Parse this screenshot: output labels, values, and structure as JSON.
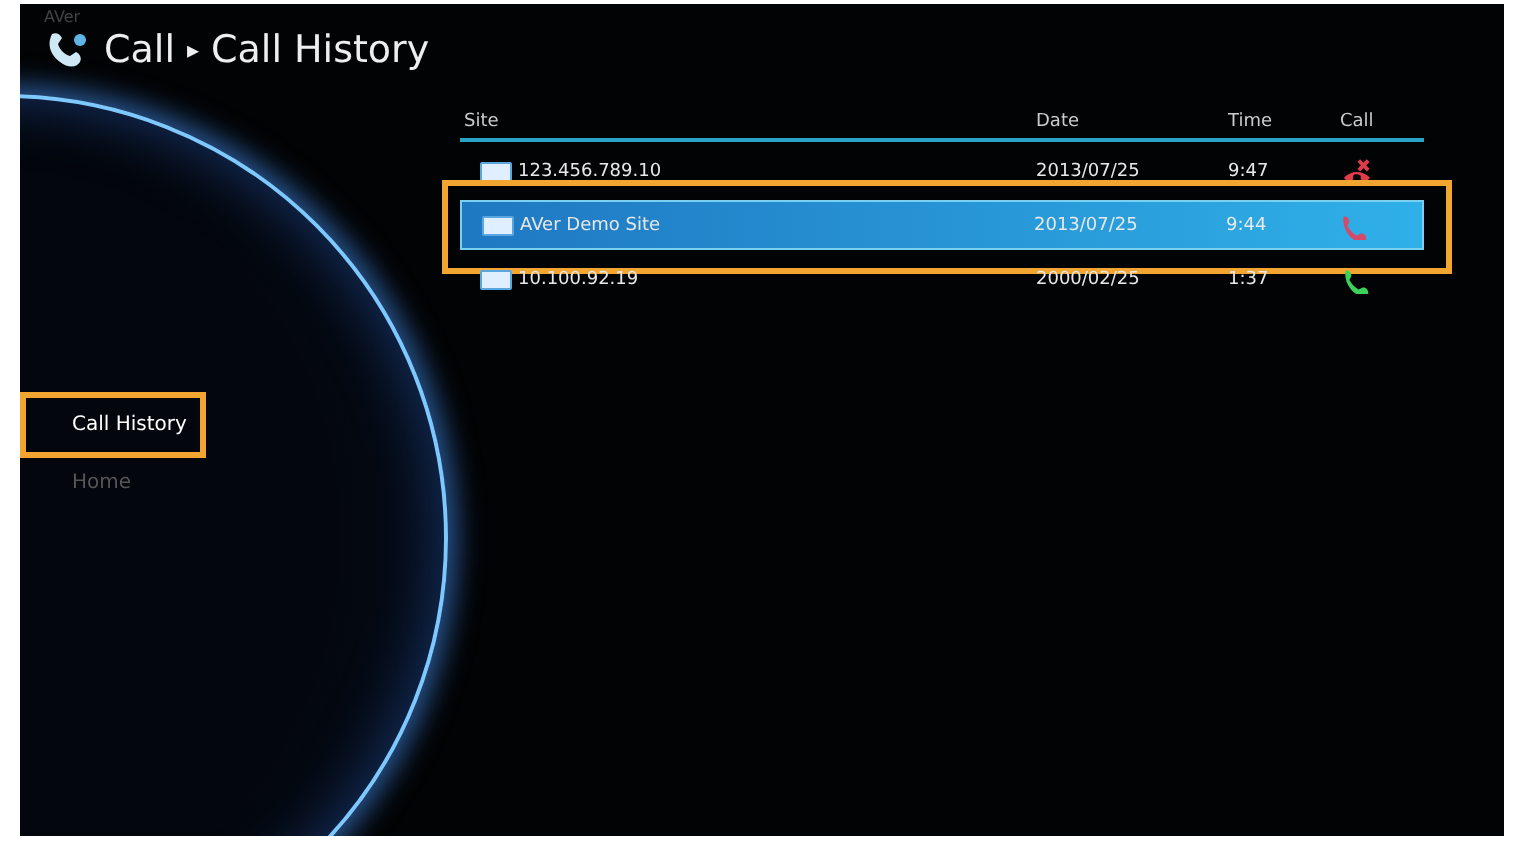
{
  "brand": "AVer",
  "breadcrumb": {
    "section": "Call",
    "separator": "▸",
    "page": "Call History"
  },
  "sidebar": {
    "items": [
      {
        "label": "Call History",
        "selected": true
      },
      {
        "label": "Home",
        "selected": false
      }
    ]
  },
  "table": {
    "columns": [
      "Site",
      "Date",
      "Time",
      "Call"
    ],
    "rows": [
      {
        "site": "123.456.789.10",
        "date": "2013/07/25",
        "time": "9:47",
        "kind": "missed",
        "selected": false
      },
      {
        "site": "AVer Demo Site",
        "date": "2013/07/25",
        "time": "9:44",
        "kind": "outgoing",
        "selected": true
      },
      {
        "site": "10.100.92.19",
        "date": "2000/02/25",
        "time": "1:37",
        "kind": "incoming",
        "selected": false
      }
    ]
  }
}
